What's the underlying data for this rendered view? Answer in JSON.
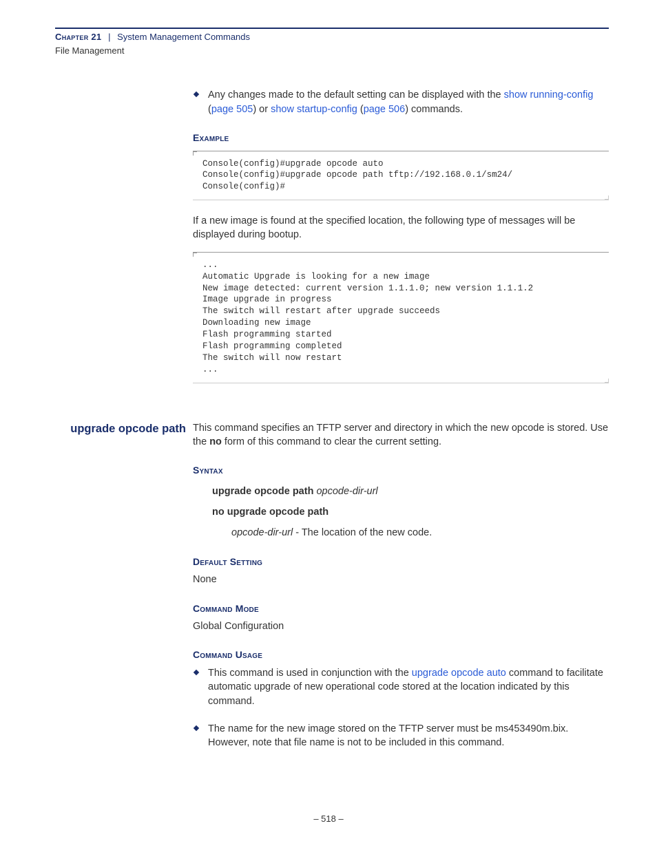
{
  "header": {
    "chapter": "Chapter 21",
    "section": "System Management Commands",
    "subtitle": "File Management"
  },
  "top_bullet": {
    "prefix": "Any changes made to the default setting can be displayed with the ",
    "link1": "show running-config",
    "paren1_open": " (",
    "page1": "page 505",
    "paren1_close": ") or ",
    "link2": "show startup-config",
    "paren2_open": " (",
    "page2": "page 506",
    "paren2_close": ") commands."
  },
  "example_head": "Example",
  "example_code": "Console(config)#upgrade opcode auto\nConsole(config)#upgrade opcode path tftp://192.168.0.1/sm24/\nConsole(config)#",
  "bootup_para": "If a new image is found at the specified location, the following type of messages will be displayed during bootup.",
  "bootup_code": "...\nAutomatic Upgrade is looking for a new image\nNew image detected: current version 1.1.1.0; new version 1.1.1.2\nImage upgrade in progress\nThe switch will restart after upgrade succeeds\nDownloading new image\nFlash programming started\nFlash programming completed\nThe switch will now restart\n...",
  "cmd": {
    "title": "upgrade opcode path",
    "desc_pre": "This command specifies an TFTP server and directory in which the new opcode is stored. Use the ",
    "desc_bold": "no",
    "desc_post": " form of this command to clear the current setting."
  },
  "syntax": {
    "head": "Syntax",
    "line1_bold": "upgrade opcode path ",
    "line1_ital": "opcode-dir-url",
    "line2": "no upgrade opcode path",
    "desc_ital": "opcode-dir-url",
    "desc_rest": " - The location of the new code."
  },
  "default": {
    "head": "Default Setting",
    "body": "None"
  },
  "mode": {
    "head": "Command Mode",
    "body": "Global Configuration"
  },
  "usage": {
    "head": "Command Usage",
    "b1_pre": "This command is used in conjunction with the ",
    "b1_link": "upgrade opcode auto",
    "b1_post": " command to facilitate automatic upgrade of new operational code stored at the location indicated by this command.",
    "b2": "The name for the new image stored on the TFTP server must be ms453490m.bix. However, note that file name is not to be included in this command."
  },
  "page_num": "–  518  –"
}
